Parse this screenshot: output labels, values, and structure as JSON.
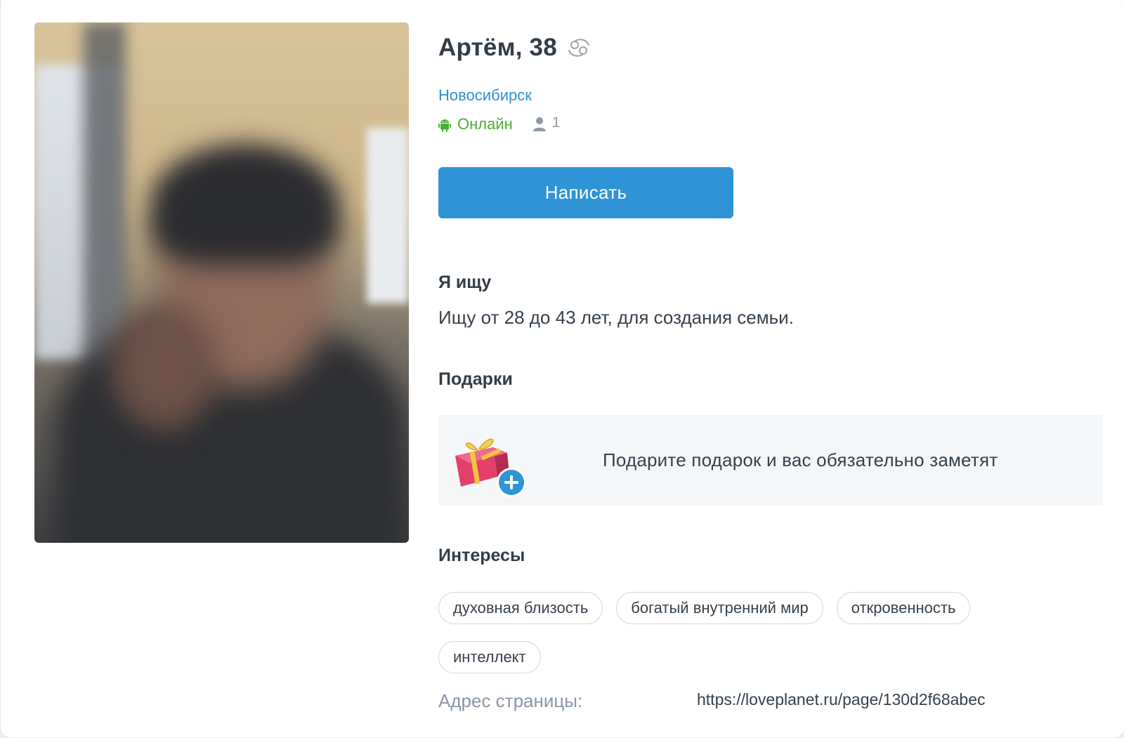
{
  "profile": {
    "name": "Артём, 38",
    "zodiac_icon": "cancer-zodiac-icon",
    "city": "Новосибирск",
    "platform_icon": "android-icon",
    "online_status": "Онлайн",
    "visitor_icon": "person-icon",
    "visitor_count": "1",
    "photo_alt": "profile-photo"
  },
  "actions": {
    "write_label": "Написать"
  },
  "seeking": {
    "title": "Я ищу",
    "text": "Ищу от 28 до 43 лет, для создания семьи."
  },
  "gifts": {
    "title": "Подарки",
    "icon": "gift-plus-icon",
    "prompt": "Подарите подарок и вас обязательно заметят"
  },
  "interests": {
    "title": "Интересы",
    "tags": [
      "духовная близость",
      "богатый внутренний мир",
      "откровенность",
      "интеллект"
    ]
  },
  "page_address": {
    "label": "Адрес страницы:",
    "value": "https://loveplanet.ru/page/130d2f68abec"
  },
  "colors": {
    "accent": "#2f94d6",
    "link": "#2d8fd5",
    "online": "#4caf35"
  }
}
